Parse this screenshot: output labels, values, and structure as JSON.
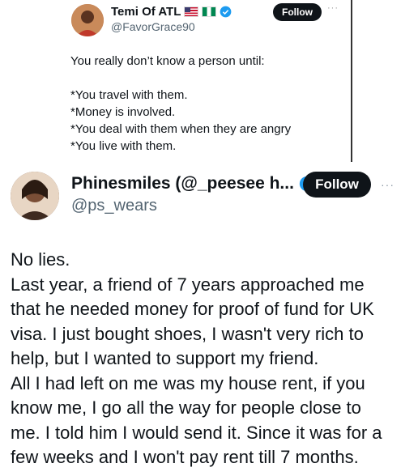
{
  "quoted_tweet": {
    "display_name": "Temi Of ATL",
    "handle": "@FavorGrace90",
    "follow_label": "Follow",
    "more_label": "···",
    "lines": [
      "You really don’t know a person until:",
      "",
      "*You travel with them.",
      "*Money is involved.",
      "*You deal with them when they are angry",
      "*You live with them."
    ]
  },
  "reply_tweet": {
    "display_name": "Phinesmiles (@_peesee h...",
    "handle": "@ps_wears",
    "follow_label": "Follow",
    "more_label": "···",
    "lines": [
      "No lies.",
      "Last year, a friend of 7 years approached me",
      "that he needed money for proof of fund for UK",
      "visa. I just bought shoes, I wasn't very rich to",
      "help, but I wanted to support my friend.",
      "All I had left on me was my house rent, if you",
      "know me, I go all the way for people close to",
      "me. I told him I would send it. Since it was for a",
      "few weeks and I won't pay rent till 7 months."
    ]
  },
  "colors": {
    "text": "#0f1419",
    "secondary": "#536471",
    "verified": "#1d9bf0",
    "button_bg": "#0f1419"
  },
  "icons": {
    "verified": "verified-badge-icon",
    "more": "more-options-icon",
    "flags": [
      "us-flag-icon",
      "nigeria-flag-icon"
    ]
  }
}
